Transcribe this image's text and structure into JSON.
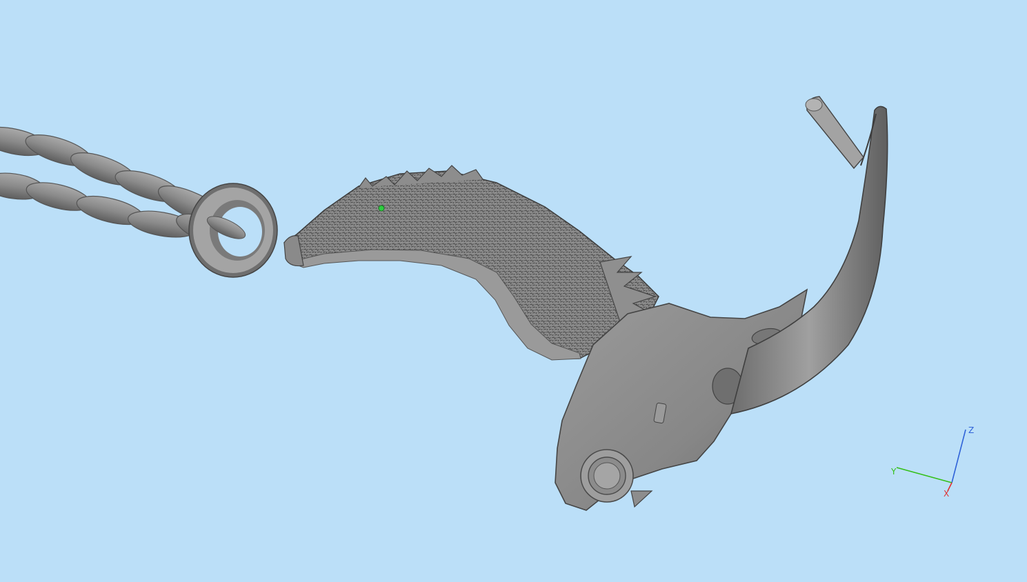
{
  "viewport": {
    "background": "#bbdff8",
    "model": {
      "chain_color": "#8c8c8c",
      "body_color": "#8a8a8a",
      "pick_point_color": "#2ecc40"
    },
    "axes": {
      "x_label": "X",
      "y_label": "Y",
      "z_label": "Z",
      "x_color": "#e03030",
      "y_color": "#34c018",
      "z_color": "#2f62d8"
    }
  }
}
